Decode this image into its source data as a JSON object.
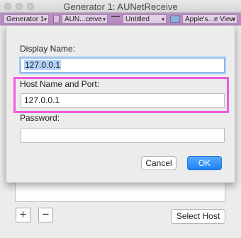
{
  "window": {
    "title": "Generator 1: AUNetReceive"
  },
  "toolbar": {
    "generator_select": "Generator 1",
    "plugin_select": "AUN...ceive",
    "preset_select": "Untitled",
    "view_select": "Apple's...e View"
  },
  "dialog": {
    "display_name_label": "Display Name:",
    "display_name_value": "127.0.0.1",
    "host_label": "Host Name and Port:",
    "host_value": "127.0.0.1",
    "password_label": "Password:",
    "password_value": "",
    "cancel_label": "Cancel",
    "ok_label": "OK"
  },
  "main": {
    "add_label": "+",
    "remove_label": "−",
    "select_host_label": "Select Host"
  },
  "colors": {
    "accent": "#1a82f6",
    "highlight": "#f05be0",
    "toolbar": "#b98ec2"
  }
}
